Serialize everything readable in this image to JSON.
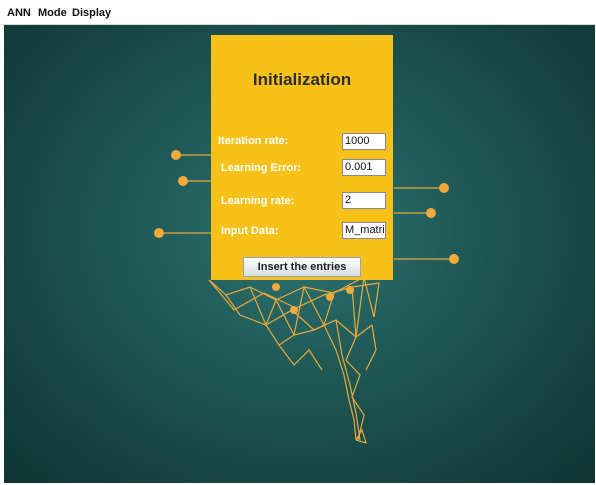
{
  "menu": {
    "ann": "ANN",
    "mode": "Mode",
    "display": "Display"
  },
  "panel": {
    "title": "Initialization",
    "fields": [
      {
        "label": "Iteration rate:",
        "value": "1000"
      },
      {
        "label": "Learning Error:",
        "value": "0.001"
      },
      {
        "label": "Learning rate:",
        "value": "2"
      },
      {
        "label": "Input Data:",
        "value": "M_matrice"
      }
    ],
    "submit_label": "Insert the entries"
  },
  "colors": {
    "panel": "#f7c11a",
    "background": "#1d5552",
    "network": "#e8a93a"
  },
  "icons": {
    "network": "neural-network-illustration"
  }
}
